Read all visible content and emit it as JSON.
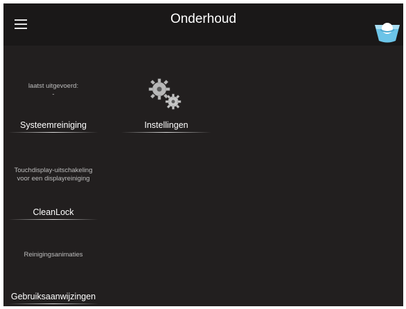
{
  "header": {
    "title": "Onderhoud"
  },
  "tiles": [
    {
      "id": "systeemreiniging",
      "caption_lines": [
        "laatst uitgevoerd:",
        "-"
      ],
      "label": "Systeemreiniging"
    },
    {
      "id": "instellingen",
      "icon": "gears-icon",
      "label": "Instellingen"
    },
    {
      "id": "cleanlock",
      "caption_lines": [
        "Touchdisplay-uitschakeling",
        "voor een displayreiniging"
      ],
      "label": "CleanLock"
    },
    {
      "id": "reinigingsanimaties",
      "caption_lines": [
        "Reinigingsanimaties"
      ],
      "label": ""
    },
    {
      "id": "gebruiksaanwijzingen",
      "label": "Gebruiksaanwijzingen"
    }
  ],
  "icons": {
    "menu": "hamburger-menu-icon",
    "top_right": "bowl-icon"
  },
  "colors": {
    "background": "#221f1f",
    "header": "#1a1818",
    "text": "#ffffff",
    "secondary_text": "#bdbdbd",
    "icon_accent": "#6cc4e8"
  }
}
